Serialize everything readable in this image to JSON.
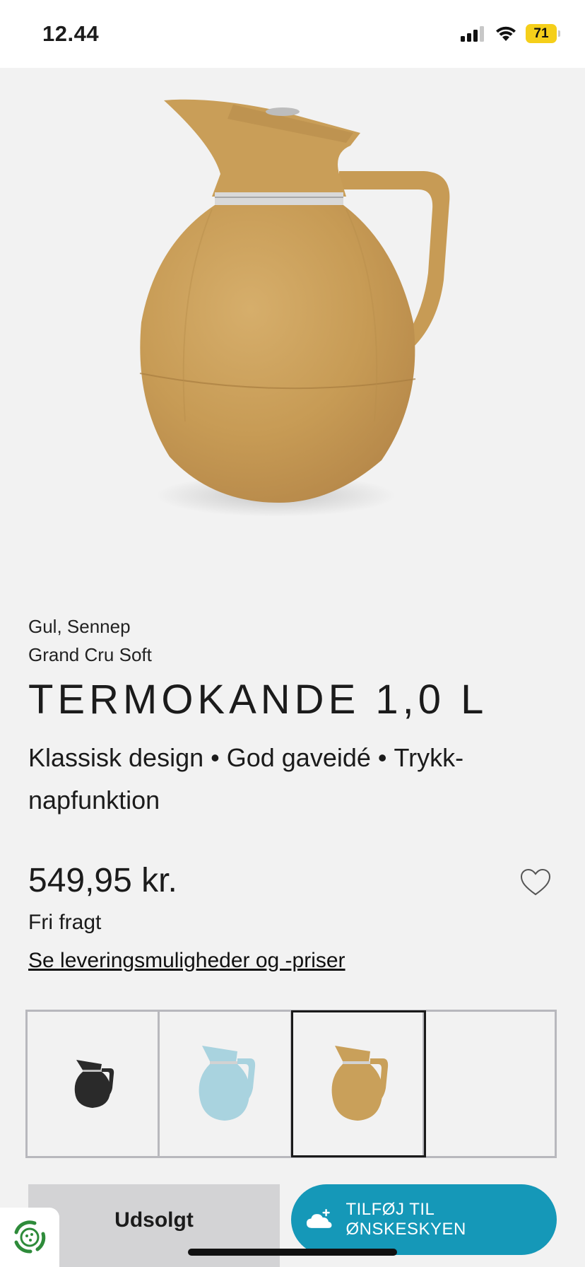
{
  "status_bar": {
    "time": "12.44",
    "battery": "71",
    "icons": [
      "cellular-signal-icon",
      "wifi-icon",
      "battery-icon"
    ]
  },
  "product": {
    "color": "Gul, Sennep",
    "collection": "Grand Cru Soft",
    "title": "TERMOKANDE 1,0 L",
    "features": [
      "Klassisk design",
      "God gaveidé",
      "Trykk-napfunktion"
    ],
    "feature_separator": "•",
    "price": "549,95 kr.",
    "shipping": "Fri fragt",
    "delivery_link": "Se leveringsmuligheder og -priser"
  },
  "variants": [
    {
      "name": "Sort",
      "color": "#2a2a2a",
      "selected": false
    },
    {
      "name": "Lyseblå",
      "color": "#a9d3df",
      "selected": false
    },
    {
      "name": "Gul, Sennep",
      "color": "#c9a05a",
      "selected": true
    },
    {
      "name": "",
      "color": "",
      "selected": false
    }
  ],
  "actions": {
    "sold_out_label": "Udsolgt",
    "wishlist_label": "TILFØJ TIL ØNSKESKYEN"
  },
  "colors": {
    "accent": "#1598b8",
    "product_mustard": "#c9a05a",
    "sold_out_bg": "#d3d3d5",
    "page_bg": "#f2f2f2"
  }
}
